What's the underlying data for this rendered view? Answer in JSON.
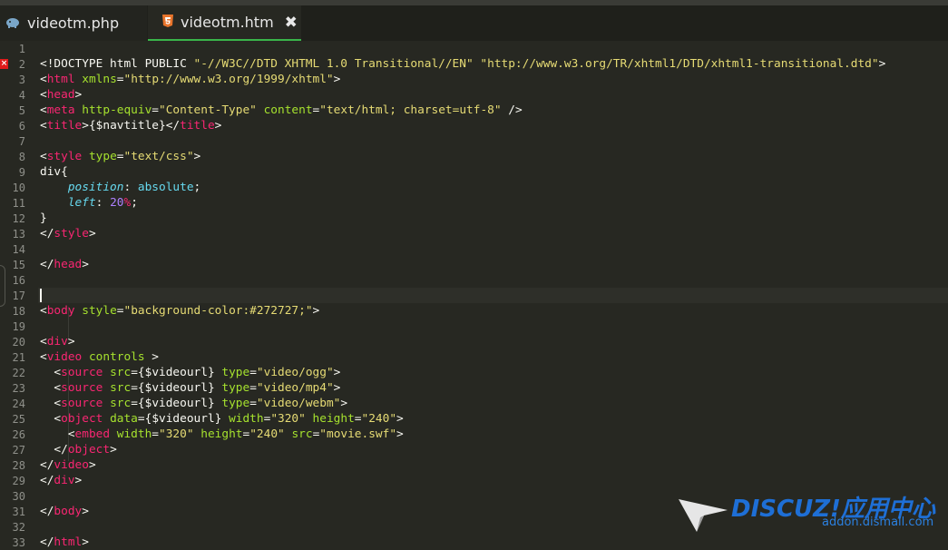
{
  "tabs": [
    {
      "label": "videotm.php",
      "icon": "php-elephant-icon",
      "active": false
    },
    {
      "label": "videotm.htm",
      "icon": "html5-icon",
      "active": true,
      "close": "✖"
    }
  ],
  "line_numbers": [
    "1",
    "2",
    "3",
    "4",
    "5",
    "6",
    "7",
    "8",
    "9",
    "10",
    "11",
    "12",
    "13",
    "14",
    "15",
    "16",
    "17",
    "18",
    "19",
    "20",
    "21",
    "22",
    "23",
    "24",
    "25",
    "26",
    "27",
    "28",
    "29",
    "30",
    "31",
    "32",
    "33"
  ],
  "error_marker": {
    "line": "2",
    "glyph": "×",
    "color": "#e01b1b"
  },
  "code": {
    "l2": {
      "doctype": "<!DOCTYPE html PUBLIC ",
      "fpi": "\"-//W3C//DTD XHTML 1.0 Transitional//EN\"",
      "sp": " ",
      "dtd": "\"http://www.w3.org/TR/xhtml1/DTD/xhtml1-transitional.dtd\"",
      "end": ">"
    },
    "l3": {
      "open": "<",
      "tag": "html",
      "attr": " xmlns",
      "eq": "=",
      "val": "\"http://www.w3.org/1999/xhtml\"",
      "end": ">"
    },
    "l4": {
      "open": "<",
      "tag": "head",
      "end": ">"
    },
    "l5": {
      "open": "<",
      "tag": "meta",
      "attr1": " http-equiv",
      "eq": "=",
      "val1": "\"Content-Type\"",
      "attr2": " content",
      "val2": "\"text/html; charset=utf-8\"",
      "end": " />"
    },
    "l6": {
      "open": "<",
      "tag": "title",
      "mid": ">{$navtitle}</",
      "tag2": "title",
      "end": ">"
    },
    "l8": {
      "open": "<",
      "tag": "style",
      "attr": " type",
      "eq": "=",
      "val": "\"text/css\"",
      "end": ">"
    },
    "l9": {
      "text": "div{"
    },
    "l10": {
      "indent": "    ",
      "prop": "position",
      "colon": ": ",
      "val": "absolute",
      "end": ";"
    },
    "l11": {
      "indent": "    ",
      "prop": "left",
      "colon": ": ",
      "num": "20",
      "unit": "%",
      "end": ";"
    },
    "l12": {
      "text": "}"
    },
    "l13": {
      "open": "</",
      "tag": "style",
      "end": ">"
    },
    "l15": {
      "open": "</",
      "tag": "head",
      "end": ">"
    },
    "l18": {
      "open": "<",
      "tag": "body",
      "attr": " style",
      "eq": "=",
      "val": "\"background-color:#272727;\"",
      "end": ">"
    },
    "l20": {
      "open": "<",
      "tag": "div",
      "end": ">"
    },
    "l21": {
      "open": "<",
      "tag": "video",
      "attr": " controls",
      "end": " >"
    },
    "l22": {
      "open": "  <",
      "tag": "source",
      "attr1": " src",
      "eq": "=",
      "val1": "{$videourl}",
      "attr2": " type",
      "val2": "\"video/ogg\"",
      "end": ">"
    },
    "l23": {
      "open": "  <",
      "tag": "source",
      "attr1": " src",
      "eq": "=",
      "val1": "{$videourl}",
      "attr2": " type",
      "val2": "\"video/mp4\"",
      "end": ">"
    },
    "l24": {
      "open": "  <",
      "tag": "source",
      "attr1": " src",
      "eq": "=",
      "val1": "{$videourl}",
      "attr2": " type",
      "val2": "\"video/webm\"",
      "end": ">"
    },
    "l25": {
      "open": "  <",
      "tag": "object",
      "attr1": " data",
      "eq": "=",
      "val1": "{$videourl}",
      "attr2": " width",
      "val2": "\"320\"",
      "attr3": " height",
      "val3": "\"240\"",
      "end": ">"
    },
    "l26": {
      "open": "    <",
      "tag": "embed",
      "attr1": " width",
      "eq": "=",
      "val1": "\"320\"",
      "attr2": " height",
      "val2": "\"240\"",
      "attr3": " src",
      "val3": "\"movie.swf\"",
      "end": ">"
    },
    "l27": {
      "open": "  </",
      "tag": "object",
      "end": ">"
    },
    "l28": {
      "open": "</",
      "tag": "video",
      "end": ">"
    },
    "l29": {
      "open": "</",
      "tag": "div",
      "end": ">"
    },
    "l31": {
      "open": "</",
      "tag": "body",
      "end": ">"
    },
    "l33": {
      "open": "</",
      "tag": "html",
      "end": ">"
    }
  },
  "watermark": {
    "logo": "DISCUZ!应用中心",
    "url": "addon.dismall.com"
  },
  "colors": {
    "background": "#272822",
    "tag": "#f92672",
    "attr": "#a6e22e",
    "string": "#e6db74",
    "keyword": "#66d9ef",
    "number": "#ae81ff",
    "active_tab_underline": "#39b54a"
  }
}
